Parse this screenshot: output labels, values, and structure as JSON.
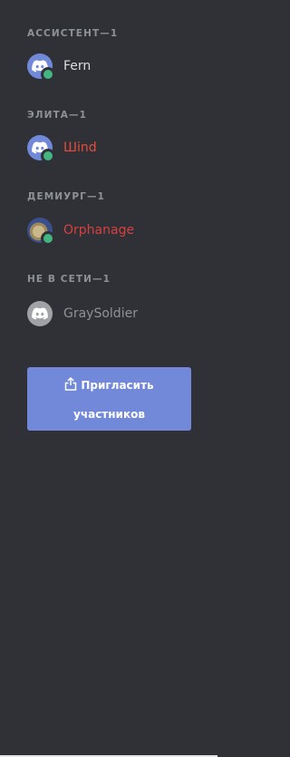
{
  "colors": {
    "background": "#2f3136",
    "header_text": "#8e9297",
    "online_status": "#43b581",
    "blurple": "#7289da",
    "offline_avatar": "#a0a2a6",
    "button_text": "#ffffff"
  },
  "groups": [
    {
      "header": "АССИСТЕНТ—1",
      "members": [
        {
          "name": "Fern",
          "name_color": "#dcddde",
          "avatar": "discord-logo-icon",
          "status": "online"
        }
      ]
    },
    {
      "header": "ЭЛИТА—1",
      "members": [
        {
          "name": "Шind",
          "name_color": "#e74c3c",
          "avatar": "discord-logo-icon",
          "status": "online"
        }
      ]
    },
    {
      "header": "ДЕМИУРГ—1",
      "members": [
        {
          "name": "Orphanage",
          "name_color": "#d84040",
          "avatar": "user-photo",
          "status": "online"
        }
      ]
    },
    {
      "header": "НЕ В СЕТИ—1",
      "members": [
        {
          "name": "GraySoldier",
          "name_color": "#8e9297",
          "avatar": "discord-logo-icon",
          "status": "offline"
        }
      ]
    }
  ],
  "invite_button": {
    "icon": "share-upload-icon",
    "label_line1": "Пригласить",
    "label_line2": "участников"
  }
}
